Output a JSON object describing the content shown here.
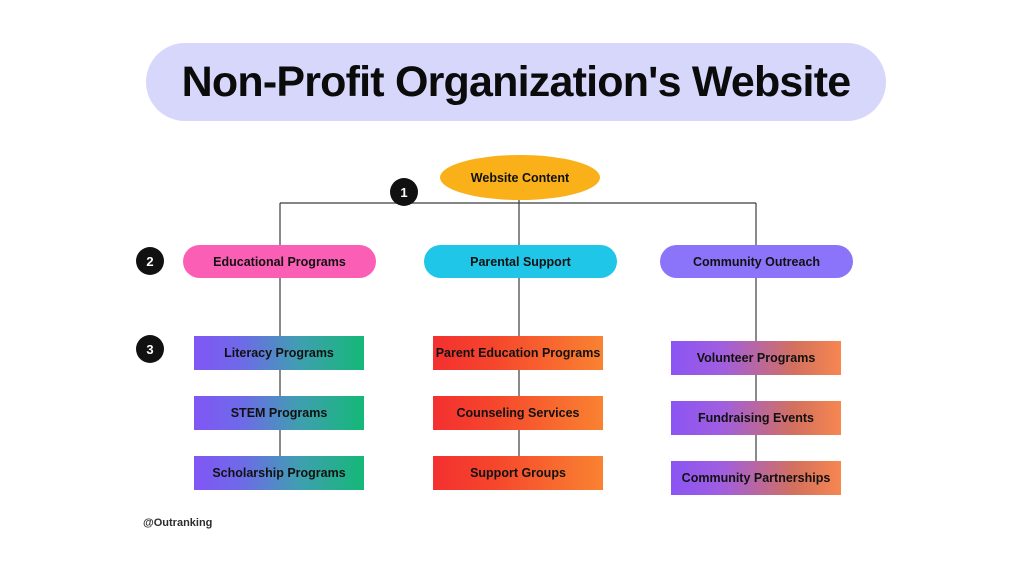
{
  "header": {
    "title": "Non-Profit Organization's Website",
    "banner_color": "#d6d7fb",
    "title_color": "#0b0b0b"
  },
  "diagram": {
    "type": "hierarchy-tree",
    "root": {
      "label": "Website Content",
      "shape": "ellipse",
      "color": "#f9b019"
    },
    "badges": [
      {
        "label": "1",
        "level": "root-level"
      },
      {
        "label": "2",
        "level": "category-level"
      },
      {
        "label": "3",
        "level": "item-level"
      }
    ],
    "branches": [
      {
        "label": "Educational Programs",
        "color": "#fb5fb5",
        "shape": "pill",
        "children": [
          {
            "label": "Literacy Programs",
            "gradient_from": "#8156f5",
            "gradient_to": "#14b877"
          },
          {
            "label": "STEM Programs",
            "gradient_from": "#8156f5",
            "gradient_to": "#14b877"
          },
          {
            "label": "Scholarship Programs",
            "gradient_from": "#8156f5",
            "gradient_to": "#14b877"
          }
        ]
      },
      {
        "label": "Parental Support",
        "color": "#1fc6e8",
        "shape": "pill",
        "children": [
          {
            "label": "Parent Education Programs",
            "gradient_from": "#f43030",
            "gradient_to": "#f98231"
          },
          {
            "label": "Counseling Services",
            "gradient_from": "#f43030",
            "gradient_to": "#f98231"
          },
          {
            "label": "Support Groups",
            "gradient_from": "#f43030",
            "gradient_to": "#f98231"
          }
        ]
      },
      {
        "label": "Community Outreach",
        "color": "#8b74f9",
        "shape": "pill",
        "children": [
          {
            "label": "Volunteer Programs",
            "gradient_from": "#8b55f3",
            "gradient_to": "#f78650"
          },
          {
            "label": "Fundraising Events",
            "gradient_from": "#8b55f3",
            "gradient_to": "#f78650"
          },
          {
            "label": "Community Partnerships",
            "gradient_from": "#8b55f3",
            "gradient_to": "#f78650"
          }
        ]
      }
    ]
  },
  "footer": {
    "watermark": "@Outranking"
  }
}
